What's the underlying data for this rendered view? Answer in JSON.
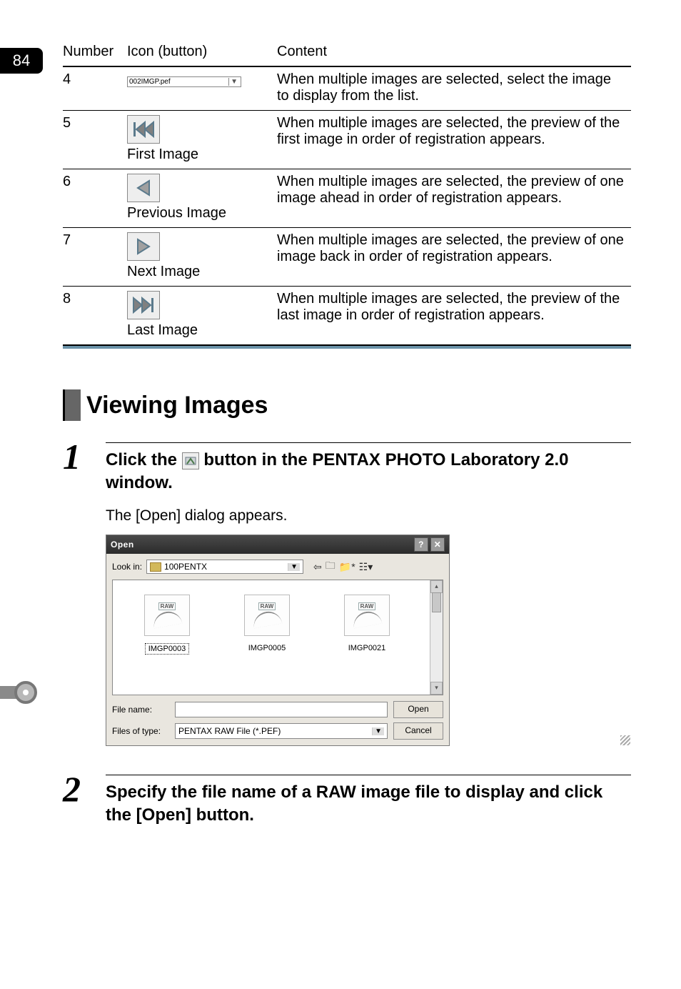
{
  "page_number": "84",
  "table": {
    "headers": [
      "Number",
      "Icon (button)",
      "Content"
    ],
    "rows": [
      {
        "number": "4",
        "icon_text": "002IMGP.pef",
        "content": "When multiple images are selected, select the image to display from the list."
      },
      {
        "number": "5",
        "icon_label": "First Image",
        "content": "When multiple images are selected, the preview of the first image in order of registration appears."
      },
      {
        "number": "6",
        "icon_label": "Previous Image",
        "content": "When multiple images are selected, the preview of one image ahead in order of registration appears."
      },
      {
        "number": "7",
        "icon_label": "Next Image",
        "content": "When multiple images are selected, the preview of one image back in order of registration appears."
      },
      {
        "number": "8",
        "icon_label": "Last Image",
        "content": "When multiple images are selected, the preview of the last image in order of registration appears."
      }
    ]
  },
  "section_heading": "Viewing Images",
  "steps": [
    {
      "num": "1",
      "title_before": "Click the ",
      "title_after": " button in the PENTAX PHOTO Laboratory 2.0 window.",
      "body": "The [Open] dialog appears."
    },
    {
      "num": "2",
      "title": "Specify the file name of a RAW image file to display and click the [Open] button."
    }
  ],
  "dialog": {
    "title": "Open",
    "look_in_label": "Look in:",
    "look_in_value": "100PENTX",
    "raw_badge": "RAW",
    "files": [
      "IMGP0003",
      "IMGP0005",
      "IMGP0021"
    ],
    "file_name_label": "File name:",
    "files_of_type_label": "Files of type:",
    "files_of_type_value": "PENTAX RAW File (*.PEF)",
    "open_button": "Open",
    "cancel_button": "Cancel"
  }
}
